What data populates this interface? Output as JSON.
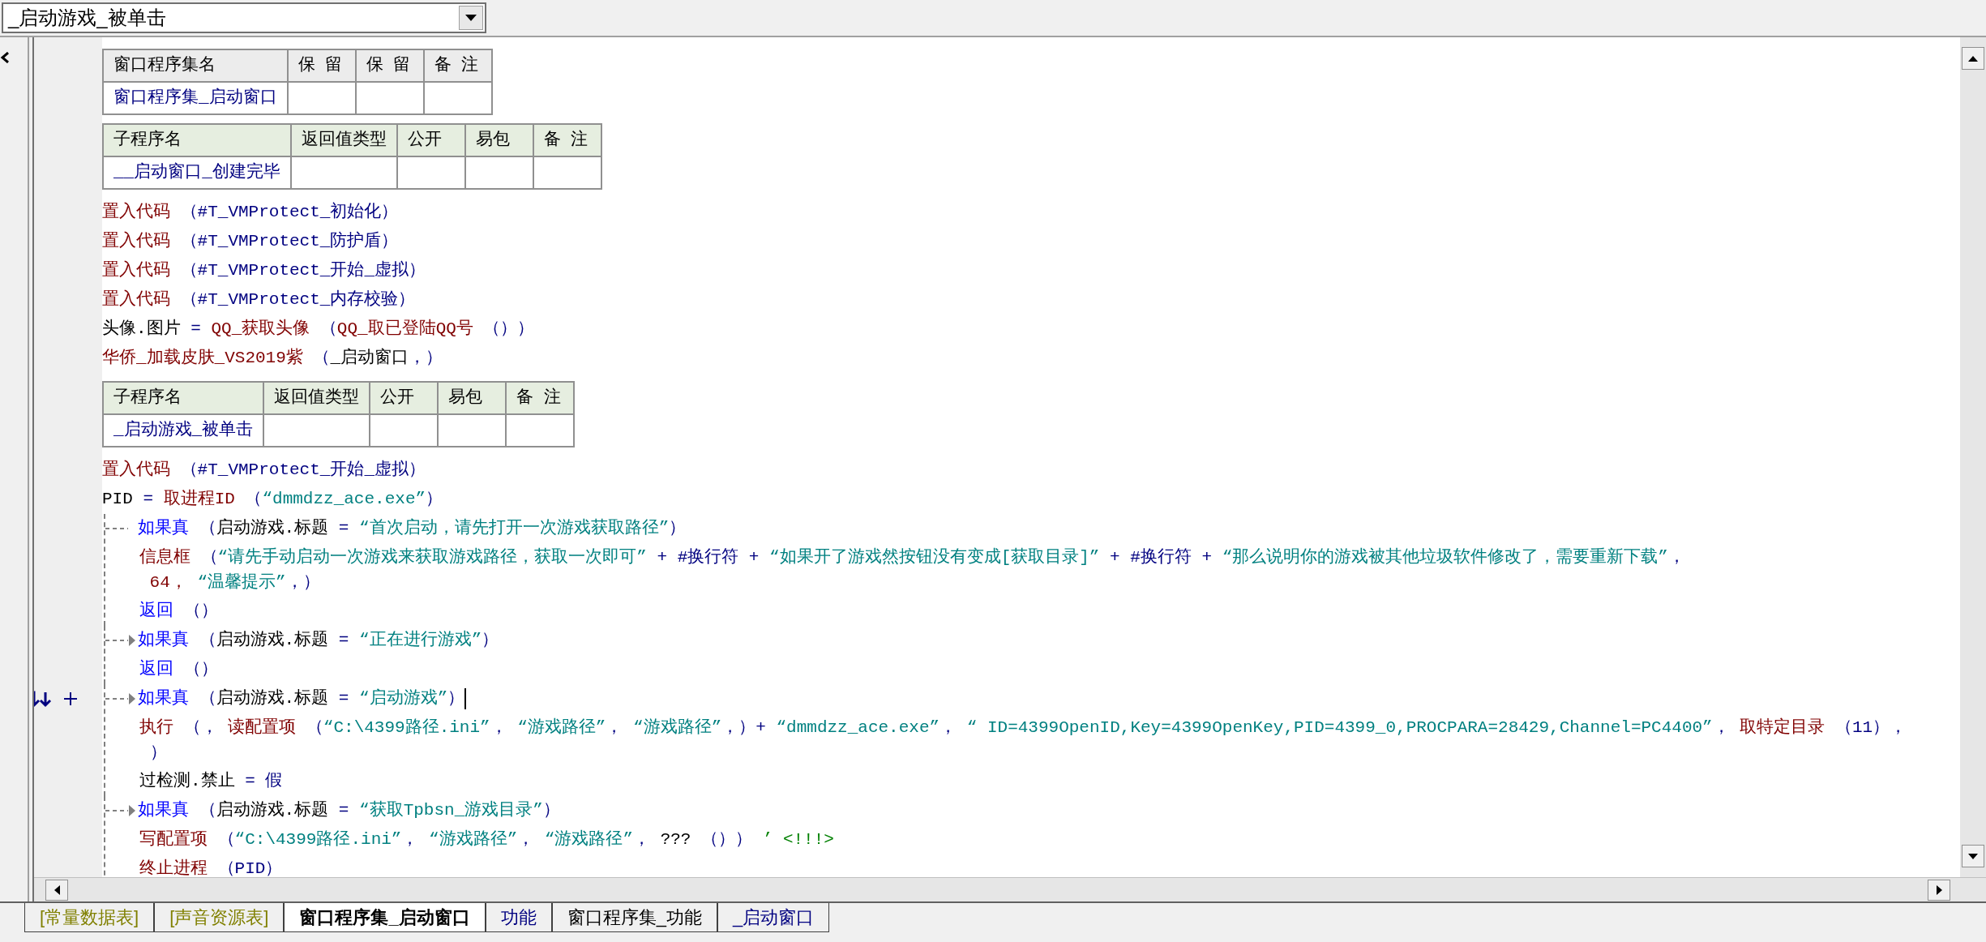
{
  "procedure_dropdown": {
    "value": "_启动游戏_被单击"
  },
  "assembly_table": {
    "columns": [
      "窗口程序集名",
      "保 留",
      "保 留",
      "备 注"
    ],
    "name": "窗口程序集_启动窗口"
  },
  "subroutines": [
    {
      "columns": [
        "子程序名",
        "返回值类型",
        "公开",
        "易包",
        "备 注"
      ],
      "name": "__启动窗口_创建完毕",
      "body": [
        {
          "kind": "line",
          "segs": [
            {
              "kind": "cmd",
              "text": "置入代码"
            },
            {
              "kind": "const",
              "text": " （#T_VMProtect_初始化）"
            }
          ]
        },
        {
          "kind": "line",
          "segs": [
            {
              "kind": "cmd",
              "text": "置入代码"
            },
            {
              "kind": "const",
              "text": " （#T_VMProtect_防护盾）"
            }
          ]
        },
        {
          "kind": "line",
          "segs": [
            {
              "kind": "cmd",
              "text": "置入代码"
            },
            {
              "kind": "const",
              "text": " （#T_VMProtect_开始_虚拟）"
            }
          ]
        },
        {
          "kind": "line",
          "segs": [
            {
              "kind": "cmd",
              "text": "置入代码"
            },
            {
              "kind": "const",
              "text": " （#T_VMProtect_内存校验）"
            }
          ]
        },
        {
          "kind": "line",
          "segs": [
            {
              "kind": "var",
              "text": "头像.图片 "
            },
            {
              "kind": "const",
              "text": "= "
            },
            {
              "kind": "cmd",
              "text": "QQ_获取头像 "
            },
            {
              "kind": "const",
              "text": "（"
            },
            {
              "kind": "cmd",
              "text": "QQ_取已登陆QQ号 "
            },
            {
              "kind": "const",
              "text": "（））"
            }
          ]
        },
        {
          "kind": "line",
          "segs": [
            {
              "kind": "cmd",
              "text": "华侨_加载皮肤_VS2019紫 "
            },
            {
              "kind": "const",
              "text": "（"
            },
            {
              "kind": "var",
              "text": "_启动窗口"
            },
            {
              "kind": "const",
              "text": "，）"
            }
          ]
        }
      ]
    },
    {
      "columns": [
        "子程序名",
        "返回值类型",
        "公开",
        "易包",
        "备 注"
      ],
      "name": "_启动游戏_被单击",
      "body": [
        {
          "kind": "line",
          "segs": [
            {
              "kind": "cmd",
              "text": "置入代码"
            },
            {
              "kind": "const",
              "text": " （#T_VMProtect_开始_虚拟）"
            }
          ]
        },
        {
          "kind": "line",
          "segs": [
            {
              "kind": "var",
              "text": "PID "
            },
            {
              "kind": "const",
              "text": "= "
            },
            {
              "kind": "cmd",
              "text": "取进程ID "
            },
            {
              "kind": "const",
              "text": "（"
            },
            {
              "kind": "str",
              "text": "“dmmdzz_ace.exe”"
            },
            {
              "kind": "const",
              "text": "）"
            }
          ]
        },
        {
          "kind": "if",
          "arrow": false,
          "current": false,
          "head": [
            {
              "kind": "flow",
              "text": "如果真 "
            },
            {
              "kind": "const",
              "text": "（"
            },
            {
              "kind": "var",
              "text": "启动游戏.标题 "
            },
            {
              "kind": "const",
              "text": "= "
            },
            {
              "kind": "str",
              "text": "“首次启动，请先打开一次游戏获取路径”"
            },
            {
              "kind": "const",
              "text": "）"
            }
          ],
          "children": [
            {
              "kind": "line",
              "segs": [
                {
                  "kind": "cmd",
                  "text": "信息框 "
                },
                {
                  "kind": "const",
                  "text": "（"
                },
                {
                  "kind": "str",
                  "text": "“请先手动启动一次游戏来获取游戏路径，获取一次即可”"
                },
                {
                  "kind": "const",
                  "text": " + #换行符 + "
                },
                {
                  "kind": "str",
                  "text": "“如果开了游戏然按钮没有变成[获取目录]”"
                },
                {
                  "kind": "const",
                  "text": " + #换行符 + "
                },
                {
                  "kind": "str",
                  "text": "“那么说明你的游戏被其他垃圾软件修改了，需要重新下载”"
                },
                {
                  "kind": "const",
                  "text": "，"
                }
              ],
              "wrap": [
                {
                  "kind": "num",
                  "text": " 64，"
                },
                {
                  "kind": "str",
                  "text": " “温馨提示”"
                },
                {
                  "kind": "const",
                  "text": "，）"
                }
              ]
            },
            {
              "kind": "line",
              "segs": [
                {
                  "kind": "flow",
                  "text": "返回 "
                },
                {
                  "kind": "const",
                  "text": "（）"
                }
              ]
            }
          ]
        },
        {
          "kind": "if",
          "arrow": true,
          "current": false,
          "head": [
            {
              "kind": "flow",
              "text": "如果真 "
            },
            {
              "kind": "const",
              "text": "（"
            },
            {
              "kind": "var",
              "text": "启动游戏.标题 "
            },
            {
              "kind": "const",
              "text": "= "
            },
            {
              "kind": "str",
              "text": "“正在进行游戏”"
            },
            {
              "kind": "const",
              "text": "）"
            }
          ],
          "children": [
            {
              "kind": "line",
              "segs": [
                {
                  "kind": "flow",
                  "text": "返回 "
                },
                {
                  "kind": "const",
                  "text": "（）"
                }
              ]
            }
          ]
        },
        {
          "kind": "if",
          "arrow": true,
          "current": true,
          "head": [
            {
              "kind": "flow",
              "text": "如果真 "
            },
            {
              "kind": "const",
              "text": "（"
            },
            {
              "kind": "var",
              "text": "启动游戏.标题 "
            },
            {
              "kind": "const",
              "text": "= "
            },
            {
              "kind": "str",
              "text": "“启动游戏”"
            },
            {
              "kind": "const",
              "text": "）"
            }
          ],
          "children": [
            {
              "kind": "line",
              "segs": [
                {
                  "kind": "cmd",
                  "text": "执行 "
                },
                {
                  "kind": "const",
                  "text": "（， "
                },
                {
                  "kind": "cmd",
                  "text": "读配置项 "
                },
                {
                  "kind": "const",
                  "text": "（"
                },
                {
                  "kind": "str",
                  "text": "“C:\\4399路径.ini”"
                },
                {
                  "kind": "const",
                  "text": "，"
                },
                {
                  "kind": "str",
                  "text": " “游戏路径”"
                },
                {
                  "kind": "const",
                  "text": "，"
                },
                {
                  "kind": "str",
                  "text": " “游戏路径”"
                },
                {
                  "kind": "const",
                  "text": "，）+ "
                },
                {
                  "kind": "str",
                  "text": "“dmmdzz_ace.exe”"
                },
                {
                  "kind": "const",
                  "text": "，"
                },
                {
                  "kind": "str",
                  "text": " “ ID=4399OpenID,Key=4399OpenKey,PID=4399_0,PROCPARA=28429,Channel=PC4400”"
                },
                {
                  "kind": "const",
                  "text": "，"
                },
                {
                  "kind": "cmd",
                  "text": " 取特定目录 "
                },
                {
                  "kind": "const",
                  "text": "（11），"
                }
              ],
              "wrap": [
                {
                  "kind": "const",
                  "text": " ）"
                }
              ]
            },
            {
              "kind": "line",
              "segs": [
                {
                  "kind": "var",
                  "text": "过检测.禁止 "
                },
                {
                  "kind": "const",
                  "text": "= 假"
                }
              ]
            }
          ]
        },
        {
          "kind": "if",
          "arrow": true,
          "current": false,
          "head": [
            {
              "kind": "flow",
              "text": "如果真 "
            },
            {
              "kind": "const",
              "text": "（"
            },
            {
              "kind": "var",
              "text": "启动游戏.标题 "
            },
            {
              "kind": "const",
              "text": "= "
            },
            {
              "kind": "str",
              "text": "“获取Tpbsn_游戏目录”"
            },
            {
              "kind": "const",
              "text": "）"
            }
          ],
          "children": [
            {
              "kind": "line",
              "segs": [
                {
                  "kind": "cmd",
                  "text": "写配置项 "
                },
                {
                  "kind": "const",
                  "text": "（"
                },
                {
                  "kind": "str",
                  "text": "“C:\\4399路径.ini”"
                },
                {
                  "kind": "const",
                  "text": "，"
                },
                {
                  "kind": "str",
                  "text": " “游戏路径”"
                },
                {
                  "kind": "const",
                  "text": "，"
                },
                {
                  "kind": "str",
                  "text": " “游戏路径”"
                },
                {
                  "kind": "const",
                  "text": "，"
                },
                {
                  "kind": "var",
                  "text": " ??? "
                },
                {
                  "kind": "const",
                  "text": "（））"
                },
                {
                  "kind": "comment",
                  "text": " ’ <!!!>"
                }
              ]
            },
            {
              "kind": "line",
              "segs": [
                {
                  "kind": "cmd",
                  "text": "终止进程 "
                },
                {
                  "kind": "const",
                  "text": "（PID）"
                }
              ]
            }
          ]
        }
      ]
    }
  ],
  "tabs": [
    {
      "label": "[常量数据表]",
      "kind": "resource",
      "selected": false
    },
    {
      "label": "[声音资源表]",
      "kind": "resource",
      "selected": false
    },
    {
      "label": "窗口程序集_启动窗口",
      "kind": "class",
      "selected": true
    },
    {
      "label": "功能",
      "kind": "sub",
      "selected": false
    },
    {
      "label": "窗口程序集_功能",
      "kind": "class",
      "selected": false
    },
    {
      "label": "_启动窗口",
      "kind": "sub",
      "selected": false
    }
  ]
}
